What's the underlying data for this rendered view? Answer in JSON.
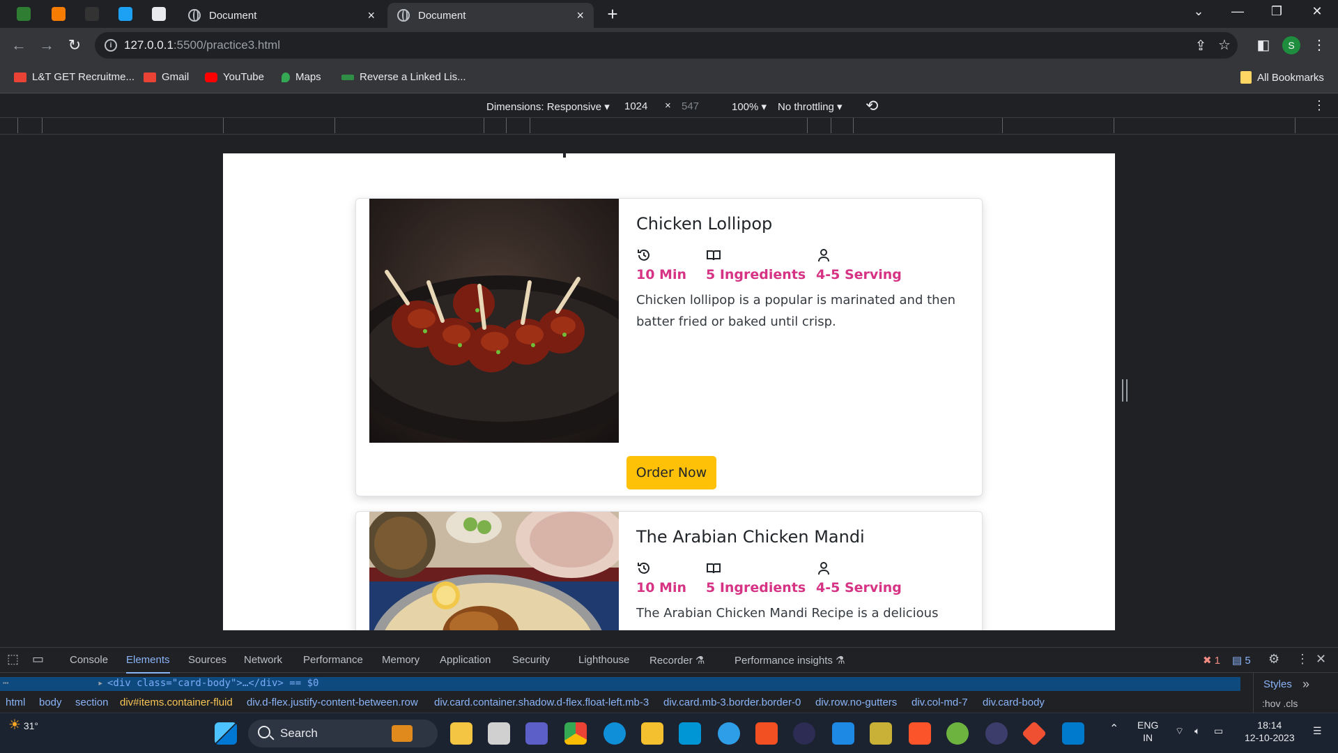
{
  "browser": {
    "tabs": [
      {
        "title": "Document",
        "close": "×",
        "active": false
      },
      {
        "title": "Document",
        "close": "×",
        "active": true
      }
    ],
    "new_tab": "+",
    "url_host": "127.0.0.1",
    "url_path": ":5500/practice3.html",
    "profile_initial": "S"
  },
  "bookmarks": [
    {
      "label": "L&T GET Recruitme...",
      "icon": "gmail-icon",
      "color": "#ea4335"
    },
    {
      "label": "Gmail",
      "icon": "gmail-icon",
      "color": "#ea4335"
    },
    {
      "label": "YouTube",
      "icon": "youtube-icon",
      "color": "#ff0000"
    },
    {
      "label": "Maps",
      "icon": "maps-icon",
      "color": "#34a853"
    },
    {
      "label": "Reverse a Linked Lis...",
      "icon": "gfg-icon",
      "color": "#2f8d46"
    },
    {
      "label": "All Bookmarks",
      "icon": "folder-icon",
      "color": "#fdd663"
    }
  ],
  "device_toolbar": {
    "dimensions": "Dimensions: Responsive ▾",
    "width": "1024",
    "times": "×",
    "height": "547",
    "zoom": "100% ▾",
    "throttling": "No throttling ▾"
  },
  "page": {
    "accent": "#d63384",
    "button_color": "#ffc107",
    "cards": [
      {
        "title": "Chicken Lollipop",
        "time": "10 Min",
        "ingredients": "5 Ingredients",
        "serving": "4-5 Serving",
        "description": "Chicken lollipop is a popular is marinated and then batter fried or baked until crisp.",
        "button": "Order Now"
      },
      {
        "title": "The Arabian Chicken Mandi",
        "time": "10 Min",
        "ingredients": "5 Ingredients",
        "serving": "4-5 Serving",
        "description": "The Arabian Chicken Mandi Recipe is a delicious"
      }
    ]
  },
  "devtools": {
    "tabs": [
      "Console",
      "Elements",
      "Sources",
      "Network",
      "Performance",
      "Memory",
      "Application",
      "Security",
      "Lighthouse",
      "Recorder ⚗",
      "Performance insights ⚗"
    ],
    "active_tab": "Elements",
    "errors": "1",
    "messages": "5",
    "selected_line": "<div class=\"card-body\">…</div> == $0",
    "breadcrumbs": [
      "html",
      "body",
      "section",
      "div#items.container-fluid",
      "div.d-flex.justify-content-between.row",
      "div.card.container.shadow.d-flex.float-left.mb-3",
      "div.card.mb-3.border.border-0",
      "div.row.no-gutters",
      "div.col-md-7",
      "div.card-body"
    ],
    "styles": "Styles",
    "hov_cls": ":hov .cls"
  },
  "taskbar": {
    "weather": "31°",
    "search": "Search",
    "lang": "ENG",
    "region": "IN",
    "time": "18:14",
    "date": "12-10-2023"
  }
}
